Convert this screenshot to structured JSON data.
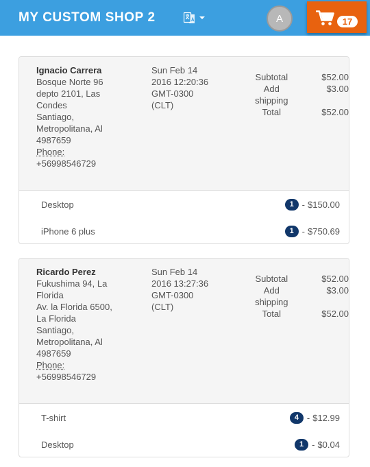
{
  "header": {
    "title": "MY CUSTOM SHOP 2",
    "language_icon": "language-icon",
    "avatar_initial": "A",
    "cart_icon": "shopping-cart-icon",
    "cart_count": "17",
    "colors": {
      "bar": "#3c9fe0",
      "cart": "#e8620f",
      "badge": "#11376a"
    }
  },
  "orders": [
    {
      "customer": "Ignacio Carrera",
      "address_lines": [
        "Bosque Norte 96",
        "depto 2101, Las",
        "Condes",
        "Santiago,",
        "Metropolitana, Al",
        "4987659"
      ],
      "phone_label": "Phone:",
      "phone": "+56998546729",
      "date_lines": [
        "Sun Feb 14",
        "2016 12:20:36",
        "GMT-0300",
        "(CLT)"
      ],
      "subtotal_label": "Subtotal",
      "subtotal": "$52.00",
      "shipping_label": "Add shipping",
      "shipping": "$3.00",
      "total_label": "Total",
      "total": "$52.00",
      "items": [
        {
          "name": "Desktop",
          "qty": "1",
          "sep": "-",
          "price": "$150.00"
        },
        {
          "name": "iPhone 6 plus",
          "qty": "1",
          "sep": "-",
          "price": "$750.69"
        }
      ]
    },
    {
      "customer": "Ricardo Perez",
      "address_lines": [
        "Fukushima 94, La",
        "Florida",
        "Av. la Florida 6500,",
        "La Florida",
        "Santiago,",
        "Metropolitana, Al",
        "4987659"
      ],
      "phone_label": "Phone:",
      "phone": "+56998546729",
      "date_lines": [
        "Sun Feb 14",
        "2016 13:27:36",
        "GMT-0300",
        "(CLT)"
      ],
      "subtotal_label": "Subtotal",
      "subtotal": "$52.00",
      "shipping_label": "Add shipping",
      "shipping": "$3.00",
      "total_label": "Total",
      "total": "$52.00",
      "items": [
        {
          "name": "T-shirt",
          "qty": "4",
          "sep": "-",
          "price": "$12.99"
        },
        {
          "name": "Desktop",
          "qty": "1",
          "sep": "-",
          "price": "$0.04"
        }
      ]
    }
  ]
}
